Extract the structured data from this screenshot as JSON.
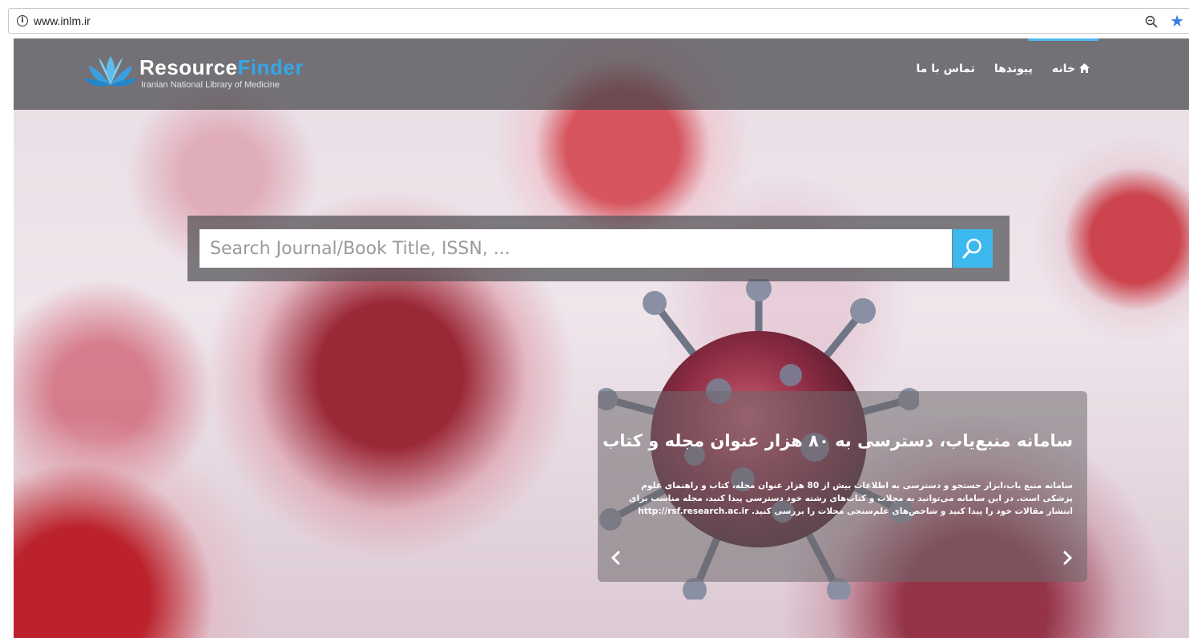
{
  "browser": {
    "url": "www.inlm.ir",
    "info_icon": "info-icon",
    "zoom_icon": "zoom-icon",
    "bookmark_icon": "star-icon"
  },
  "logo": {
    "part1": "Resource",
    "part2": "Finder",
    "subtitle": "Iranian National Library of Medicine"
  },
  "nav": {
    "items": [
      {
        "label": "خانه",
        "icon": "home-icon",
        "active": true
      },
      {
        "label": "پیوندها"
      },
      {
        "label": "تماس با ما"
      }
    ]
  },
  "search": {
    "placeholder": "Search Journal/Book Title, ISSN, ...",
    "button_icon": "search-icon"
  },
  "carousel": {
    "title": "سامانه منبع‌یاب، دسترسی به ۸۰ هزار عنوان مجله و کتاب",
    "body": "سامانه منبع یاب،ابزار جستجو و دسترسی به اطلاعات بیش از 80 هزار عنوان مجله، کتاب و راهنمای علوم پزشکی است. در این سامانه می‌توانید به مجلات و کتاب‌های رشته خود دسترسی پیدا کنید، مجله مناسب برای انتشار مقالات خود را پیدا کنید و شاخص‌های علم‌سنجی مجلات را بررسی کنید.",
    "link": "http://rsf.research.ac.ir",
    "prev_icon": "chevron-left-icon",
    "next_icon": "chevron-right-icon"
  },
  "colors": {
    "accent": "#3db8ef",
    "navbar": "#46464b"
  }
}
